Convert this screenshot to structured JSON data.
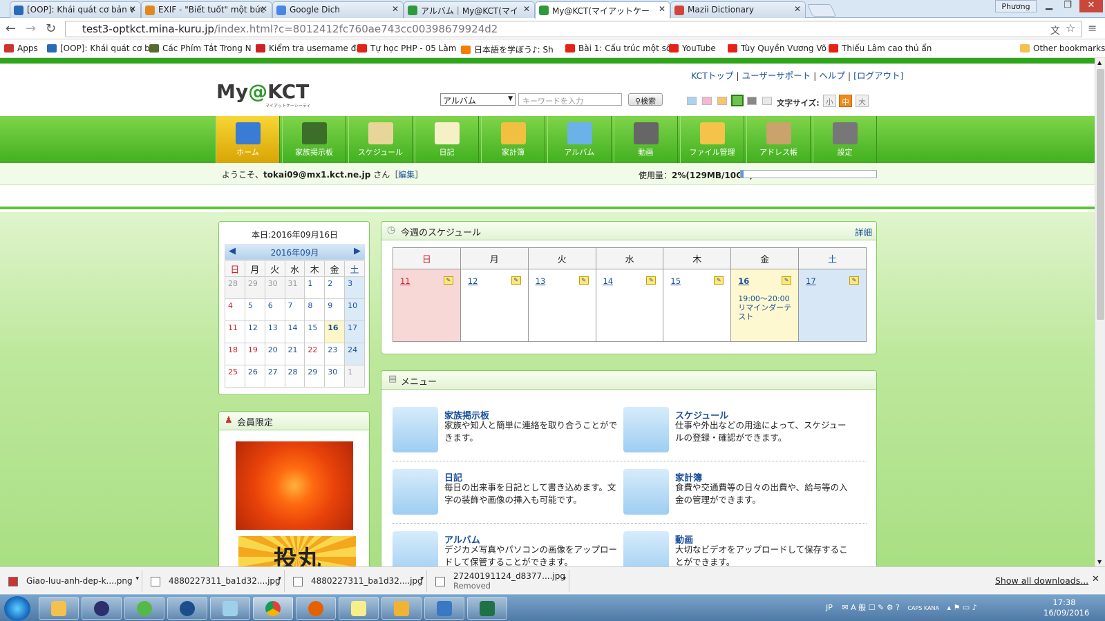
{
  "browser": {
    "tabs": [
      {
        "title": "[OOP]: Khái quát cơ bản v",
        "color": "#2a6bb5"
      },
      {
        "title": "EXIF - \"Biết tuốt\" một bức",
        "color": "#e08a1e"
      },
      {
        "title": "Google Dich",
        "color": "#4a86e8"
      },
      {
        "title": "アルバム｜My@KCT(マイ",
        "color": "#2e9a3a"
      },
      {
        "title": "My@KCT(マイアットケー",
        "color": "#2e9a3a"
      },
      {
        "title": "Mazii Dictionary",
        "color": "#d0453a"
      }
    ],
    "user_label": "Phương",
    "url_host": "test3-optkct.mina-kuru.jp",
    "url_path": "/index.html?c=8012412fc760ae743cc00398679924d2",
    "bookmarks": [
      {
        "label": "Apps",
        "color": "#cc3333"
      },
      {
        "label": "[OOP]: Khái quát cơ b",
        "color": "#2a6bb5"
      },
      {
        "label": "Các Phím Tắt Trong N",
        "color": "#556b2f"
      },
      {
        "label": "Kiểm tra username đã",
        "color": "#cc2222"
      },
      {
        "label": "Tự học PHP - 05 Làm",
        "color": "#e62117"
      },
      {
        "label": "日本語を学ぼう♪: Sh",
        "color": "#f57d00"
      },
      {
        "label": "Bài 1: Cấu trúc một số",
        "color": "#e62117"
      },
      {
        "label": "YouTube",
        "color": "#e62117"
      },
      {
        "label": "Tùy Quyền Vương Võ",
        "color": "#e62117"
      },
      {
        "label": "Thiếu Lâm cao thủ ẩn",
        "color": "#e62117"
      }
    ],
    "other_bookmarks": "Other bookmarks"
  },
  "site": {
    "top_links": [
      "KCTトップ",
      "ユーザーサポート",
      "ヘルプ",
      "[ログアウト]"
    ],
    "logo_pre": "My",
    "logo_at": "@",
    "logo_post": "KCT",
    "logo_sub": "マイアットケーシーティ",
    "search_select": "アルバム",
    "search_placeholder": "キーワードを入力",
    "search_button": "検索",
    "theme_colors": [
      "#a9d3f2",
      "#f9b6d0",
      "#f9c46b",
      "#6cc24a",
      "#888888",
      "#e8e8e8"
    ],
    "font_size_label": "文字サイズ:",
    "font_sizes": [
      "小",
      "中",
      "大"
    ],
    "nav": [
      {
        "label": "ホーム",
        "color": "#3a7bd5"
      },
      {
        "label": "家族掲示板",
        "color": "#3c6e2a"
      },
      {
        "label": "スケジュール",
        "color": "#e8d59a"
      },
      {
        "label": "日記",
        "color": "#f6f0c6"
      },
      {
        "label": "家計簿",
        "color": "#f2c040"
      },
      {
        "label": "アルバム",
        "color": "#6ab2e8"
      },
      {
        "label": "動画",
        "color": "#666666"
      },
      {
        "label": "ファイル管理",
        "color": "#f4c34a"
      },
      {
        "label": "アドレス帳",
        "color": "#c9a36b"
      },
      {
        "label": "設定",
        "color": "#777777"
      }
    ],
    "welcome_pre": "ようこそ、",
    "welcome_email": "tokai09@mx1.kct.ne.jp",
    "welcome_post": " さん［",
    "welcome_edit": "編集",
    "welcome_close": "］",
    "usage_label": "使用量：",
    "usage_value": "2%(129MB/10GB)",
    "usage_fraction": 0.02
  },
  "calendar": {
    "today": "本日:2016年09月16日",
    "month": "2016年09月",
    "weekdays": [
      "日",
      "月",
      "火",
      "水",
      "木",
      "金",
      "土"
    ],
    "weeks": [
      [
        "28",
        "29",
        "30",
        "31",
        "1",
        "2",
        "3"
      ],
      [
        "4",
        "5",
        "6",
        "7",
        "8",
        "9",
        "10"
      ],
      [
        "11",
        "12",
        "13",
        "14",
        "15",
        "16",
        "17"
      ],
      [
        "18",
        "19",
        "20",
        "21",
        "22",
        "23",
        "24"
      ],
      [
        "25",
        "26",
        "27",
        "28",
        "29",
        "30",
        "1"
      ]
    ]
  },
  "member": {
    "title": "会員限定",
    "banner_text": "投丸"
  },
  "schedule": {
    "title": "今週のスケジュール",
    "detail": "詳細",
    "days": [
      "日",
      "月",
      "火",
      "水",
      "木",
      "金",
      "土"
    ],
    "dates": [
      "11",
      "12",
      "13",
      "14",
      "15",
      "16",
      "17"
    ],
    "event_time": "19:00～20:00",
    "event_title": "リマインダーテスト"
  },
  "menu": {
    "title": "メニュー",
    "items": [
      {
        "title": "家族掲示板",
        "desc": "家族や知人と簡単に連絡を取り合うことができます。"
      },
      {
        "title": "スケジュール",
        "desc": "仕事や外出などの用途によって、スケジュールの登録・確認ができます。"
      },
      {
        "title": "日記",
        "desc": "毎日の出来事を日記として書き込めます。文字の装飾や画像の挿入も可能です。"
      },
      {
        "title": "家計簿",
        "desc": "食費や交通費等の日々の出費や、給与等の入金の管理ができます。"
      },
      {
        "title": "アルバム",
        "desc": "デジカメ写真やパソコンの画像をアップロードして保管することができます。"
      },
      {
        "title": "動画",
        "desc": "大切なビデオをアップロードして保存することができます。"
      }
    ]
  },
  "downloads": [
    {
      "name": "Giao-luu-anh-dep-k....png",
      "status": ""
    },
    {
      "name": "4880227311_ba1d32....jpg",
      "status": ""
    },
    {
      "name": "4880227311_ba1d32....jpg",
      "status": ""
    },
    {
      "name": "27240191124_d8377....jpg",
      "status": "Removed"
    }
  ],
  "show_all": "Show all downloads...",
  "taskbar": {
    "lang": "JP",
    "time": "17:38",
    "date": "16/09/2016",
    "caps": "CAPS KANA"
  }
}
